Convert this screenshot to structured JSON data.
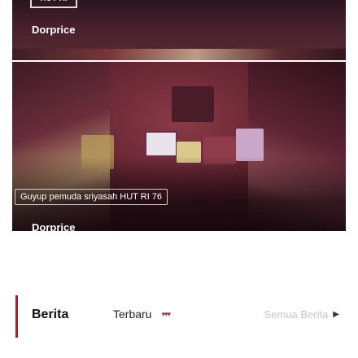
{
  "colors": {
    "accent": "#b11a2b",
    "overlay_dark": "#2a1620"
  },
  "news_cards": [
    {
      "badge": "HUT RI",
      "title": "Dorprice"
    },
    {
      "banner": "Guyup pemuda sriyasah HUT RI 76",
      "title": "Dorprice"
    }
  ],
  "category": {
    "title": "Berita",
    "sort_label": "Terbaru",
    "sort_icon": "chevron-down-icon",
    "see_all_label": "Semua Berita",
    "see_all_icon": "caret-right-icon"
  }
}
